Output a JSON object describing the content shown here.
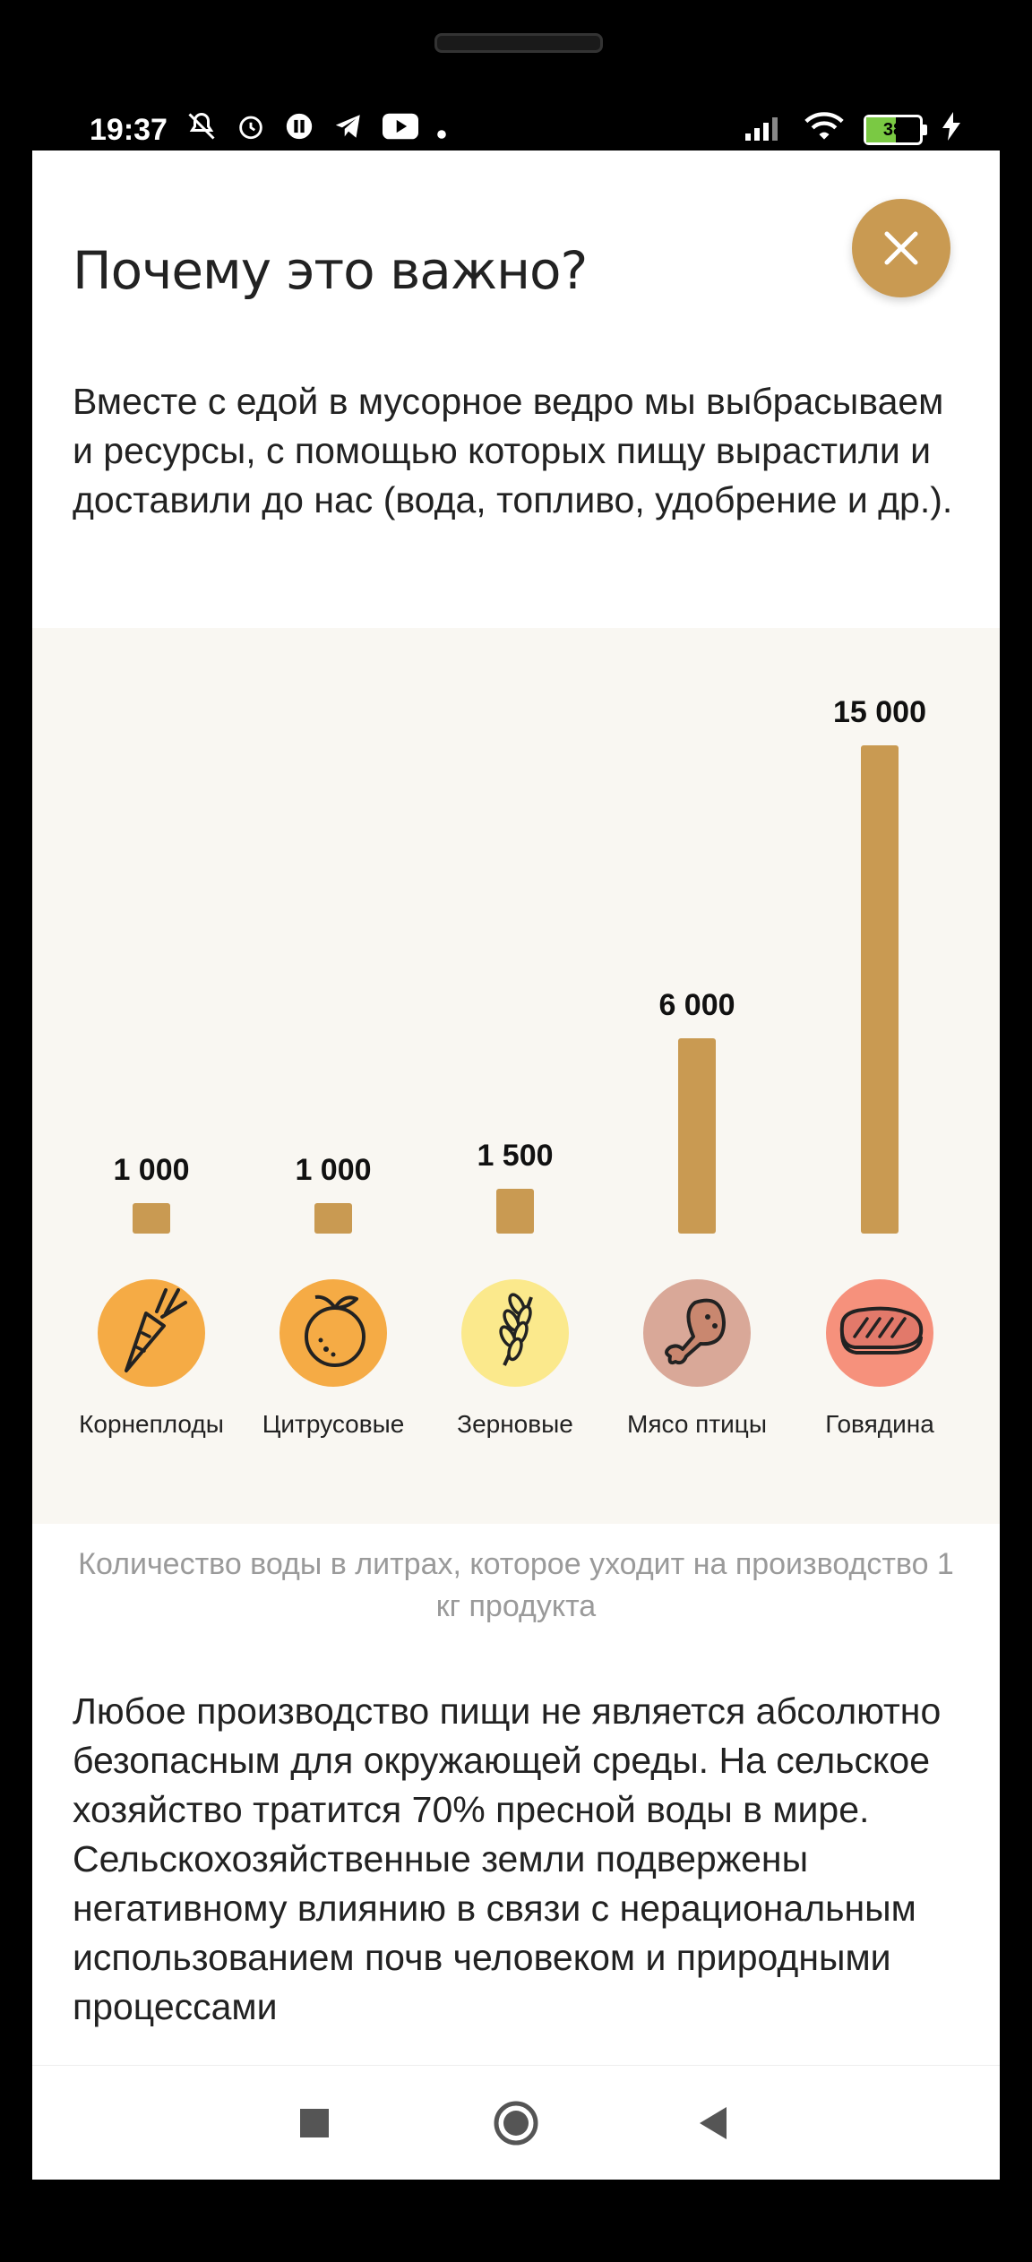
{
  "status_bar": {
    "time": "19:37",
    "battery": "38",
    "icons_left": [
      "mute-icon",
      "alarm-icon",
      "pause-icon",
      "telegram-icon",
      "youtube-icon",
      "dot-icon"
    ],
    "icons_right": [
      "signal-icon",
      "wifi-icon",
      "battery-icon",
      "charging-icon"
    ]
  },
  "header": {
    "title": "Почему это важно?",
    "close_icon": "close-icon"
  },
  "intro_text": "Вместе с едой в мусорное ведро мы выбрасываем и ресурсы, с помощью которых пищу вырастили и доставили до нас (вода, топливо, удобрение и др.).",
  "chart_data": {
    "type": "bar",
    "categories": [
      "Корнеплоды",
      "Цитрусовые",
      "Зерновые",
      "Мясо птицы",
      "Говядина"
    ],
    "values": [
      1000,
      1000,
      1500,
      6000,
      15000
    ],
    "value_labels": [
      "1 000",
      "1 000",
      "1 500",
      "6 000",
      "15 000"
    ],
    "icons": [
      "carrot-icon",
      "orange-icon",
      "wheat-icon",
      "chicken-leg-icon",
      "steak-icon"
    ],
    "icon_colors": [
      "#f5ab45",
      "#f5ab45",
      "#fbe98c",
      "#d9a898",
      "#f6917c"
    ],
    "bar_color": "#c99a52",
    "ylim": [
      0,
      15000
    ],
    "title": "",
    "xlabel": "",
    "ylabel": "",
    "grid": false
  },
  "caption": "Количество воды в литрах, которое уходит на производство 1 кг продукта",
  "body_text": "Любое производство пищи не является абсолютно безопасным для окружающей среды. На сельское хозяйство тратится 70% пресной воды в мире. Сельскохозяйственные земли подвержены негативному влиянию в связи с нерациональным использованием почв человеком и природными процессами",
  "nav": {
    "recents_icon": "square-icon",
    "home_icon": "circle-icon",
    "back_icon": "triangle-back-icon"
  },
  "colors": {
    "accent": "#c99a52",
    "panel_bg": "#f9f7f2",
    "caption": "#9a9a9a"
  }
}
